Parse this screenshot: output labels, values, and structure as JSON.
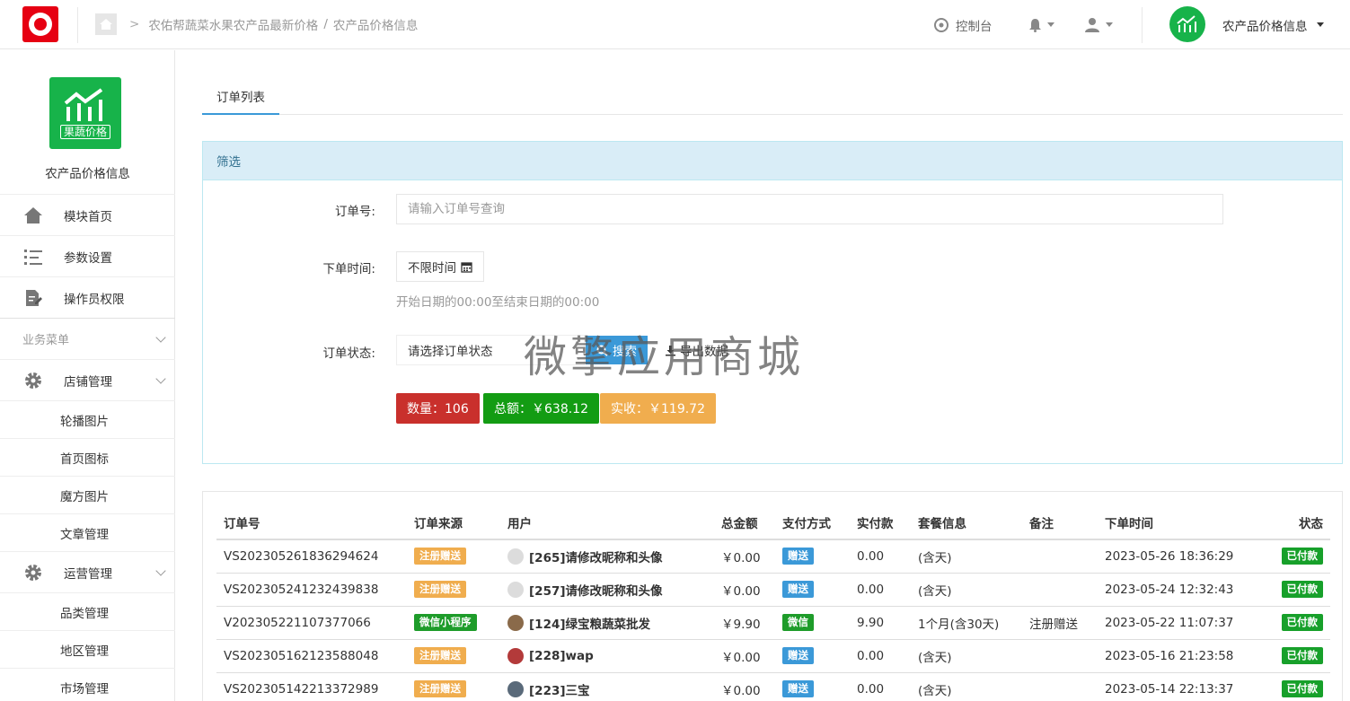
{
  "header": {
    "breadcrumb": [
      "农佑帮蔬菜水果农产品最新价格",
      "农产品价格信息"
    ],
    "console_label": "控制台",
    "app_name": "农产品价格信息",
    "brand_color": "#e60012",
    "accent_color": "#17b34a"
  },
  "sidebar": {
    "logo_text": "果蔬价格",
    "app_name": "农产品价格信息",
    "items": [
      {
        "label": "模块首页",
        "icon": "home-icon"
      },
      {
        "label": "参数设置",
        "icon": "list-icon"
      },
      {
        "label": "操作员权限",
        "icon": "edit-doc-icon"
      }
    ],
    "group_label": "业务菜单",
    "shop": {
      "label": "店铺管理",
      "icon": "gear-icon",
      "subs": [
        "轮播图片",
        "首页图标",
        "魔方图片",
        "文章管理"
      ]
    },
    "ops": {
      "label": "运营管理",
      "icon": "gear-icon",
      "subs": [
        "品类管理",
        "地区管理",
        "市场管理"
      ]
    }
  },
  "main": {
    "tab_label": "订单列表",
    "filter": {
      "title": "筛选",
      "order_no_label": "订单号:",
      "order_no_placeholder": "请输入订单号查询",
      "time_label": "下单时间:",
      "time_value": "不限时间",
      "time_hint": "开始日期的00:00至结束日期的00:00",
      "status_label": "订单状态:",
      "status_value": "请选择订单状态",
      "search_label": "搜索",
      "export_label": "导出数据",
      "watermark": "微擎应用商城",
      "stats": [
        {
          "label": "数量：106",
          "color": "#c9302c"
        },
        {
          "label": "总额：￥638.12",
          "color": "#139c13"
        },
        {
          "label": "实收：￥119.72",
          "color": "#f0ad4e"
        }
      ]
    },
    "table": {
      "headers": [
        "订单号",
        "订单来源",
        "用户",
        "总金额",
        "支付方式",
        "实付款",
        "套餐信息",
        "备注",
        "下单时间",
        "状态"
      ],
      "rows": [
        {
          "order_no": "VS202305261836294624",
          "source": "注册赠送",
          "source_type": "orange",
          "user": "[265]请修改昵称和头像",
          "avatar": "#dcdcdc",
          "total": "￥0.00",
          "pay": "赠送",
          "pay_type": "blue",
          "paid": "0.00",
          "plan": "(含天)",
          "note": "",
          "time": "2023-05-26 18:36:29",
          "status": "已付款"
        },
        {
          "order_no": "VS202305241232439838",
          "source": "注册赠送",
          "source_type": "orange",
          "user": "[257]请修改昵称和头像",
          "avatar": "#dcdcdc",
          "total": "￥0.00",
          "pay": "赠送",
          "pay_type": "blue",
          "paid": "0.00",
          "plan": "(含天)",
          "note": "",
          "time": "2023-05-24 12:32:43",
          "status": "已付款"
        },
        {
          "order_no": "V202305221107377066",
          "source": "微信小程序",
          "source_type": "green",
          "user": "[124]绿宝粮蔬菜批发",
          "avatar": "#8a6a4a",
          "total": "￥9.90",
          "pay": "微信",
          "pay_type": "green",
          "paid": "9.90",
          "plan": "1个月(含30天)",
          "note": "注册赠送",
          "time": "2023-05-22 11:07:37",
          "status": "已付款"
        },
        {
          "order_no": "VS202305162123588048",
          "source": "注册赠送",
          "source_type": "orange",
          "user": "[228]wap",
          "avatar": "#b33a3a",
          "total": "￥0.00",
          "pay": "赠送",
          "pay_type": "blue",
          "paid": "0.00",
          "plan": "(含天)",
          "note": "",
          "time": "2023-05-16 21:23:58",
          "status": "已付款"
        },
        {
          "order_no": "VS202305142213372989",
          "source": "注册赠送",
          "source_type": "orange",
          "user": "[223]三宝",
          "avatar": "#5a6a7a",
          "total": "￥0.00",
          "pay": "赠送",
          "pay_type": "blue",
          "paid": "0.00",
          "plan": "(含天)",
          "note": "",
          "time": "2023-05-14 22:13:37",
          "status": "已付款"
        }
      ]
    }
  }
}
